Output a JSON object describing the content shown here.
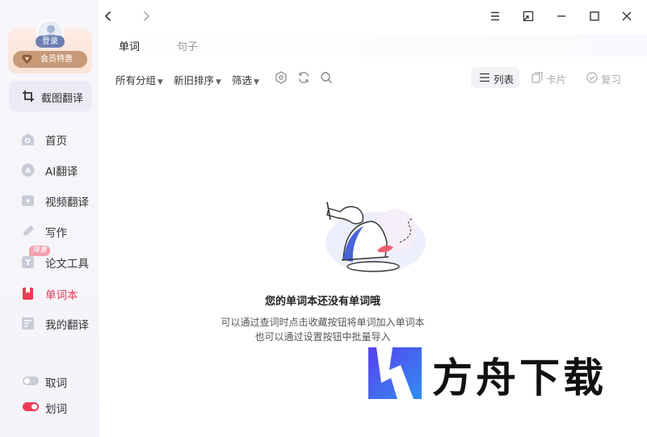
{
  "user": {
    "login_label": "登录",
    "vip_label": "会员特惠"
  },
  "sidebar": {
    "capture_label": "截图翻译",
    "items": [
      {
        "label": "首页",
        "icon": "home-icon"
      },
      {
        "label": "AI翻译",
        "icon": "ai-translate-icon"
      },
      {
        "label": "视频翻译",
        "icon": "video-icon"
      },
      {
        "label": "写作",
        "icon": "pen-icon"
      },
      {
        "label": "论文工具",
        "icon": "text-icon",
        "badge": "降重"
      },
      {
        "label": "单词本",
        "icon": "bookmark-icon",
        "active": true
      },
      {
        "label": "我的翻译",
        "icon": "document-icon"
      }
    ],
    "toggles": [
      {
        "label": "取词",
        "on": false
      },
      {
        "label": "划词",
        "on": true
      }
    ]
  },
  "tabs": [
    {
      "label": "单词",
      "active": true
    },
    {
      "label": "句子",
      "active": false
    }
  ],
  "toolbar": {
    "group_filter": "所有分组",
    "sort_filter": "新旧排序",
    "screen_filter": "筛选",
    "view_list": "列表",
    "view_card": "卡片",
    "view_review": "复习"
  },
  "empty_state": {
    "title": "您的单词本还没有单词哦",
    "line1": "可以通过查词时点击收藏按钮将单词加入单词本",
    "line2": "也可以通过设置按钮中批量导入"
  },
  "watermark": {
    "text": "方舟下载"
  },
  "colors": {
    "accent": "#ee3a55",
    "sidebar_bg": "#f5f5fa",
    "vip_gold": "#c79a78"
  }
}
